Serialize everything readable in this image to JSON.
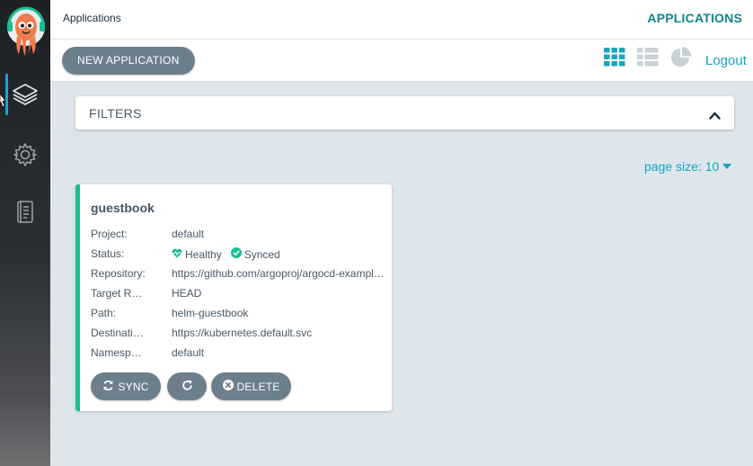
{
  "sidebar": {
    "logo": "argo-octopus-logo",
    "items": [
      {
        "icon": "layers-icon",
        "name": "Applications",
        "active": true
      },
      {
        "icon": "gear-icon",
        "name": "Settings",
        "active": false
      },
      {
        "icon": "user-info-icon",
        "name": "User Info",
        "active": false
      }
    ]
  },
  "header": {
    "breadcrumb": "Applications",
    "title": "APPLICATIONS"
  },
  "toolbar": {
    "new_app_label": "NEW APPLICATION",
    "views": [
      "grid-view-icon",
      "list-view-icon",
      "pie-chart-view-icon"
    ],
    "active_view": "grid-view-icon",
    "logout_label": "Logout"
  },
  "filters": {
    "label": "FILTERS",
    "expanded": true
  },
  "pagination": {
    "page_size_label": "page size: 10"
  },
  "apps": [
    {
      "name": "guestbook",
      "fields": [
        {
          "key": "Project:",
          "value": "default"
        },
        {
          "key": "Status:",
          "health": "Healthy",
          "sync": "Synced"
        },
        {
          "key": "Repository:",
          "value": "https://github.com/argoproj/argocd-example-apps"
        },
        {
          "key": "Target Revision:",
          "value": "HEAD"
        },
        {
          "key": "Path:",
          "value": "helm-guestbook"
        },
        {
          "key": "Destination:",
          "value": "https://kubernetes.default.svc"
        },
        {
          "key": "Namespace:",
          "value": "default"
        }
      ],
      "actions": {
        "sync_label": "SYNC",
        "delete_label": "DELETE"
      }
    }
  ],
  "colors": {
    "accent": "#13a6c1",
    "healthy": "#18be94",
    "button": "#6d7f8b",
    "sidebar_active": "#17a8c7"
  }
}
